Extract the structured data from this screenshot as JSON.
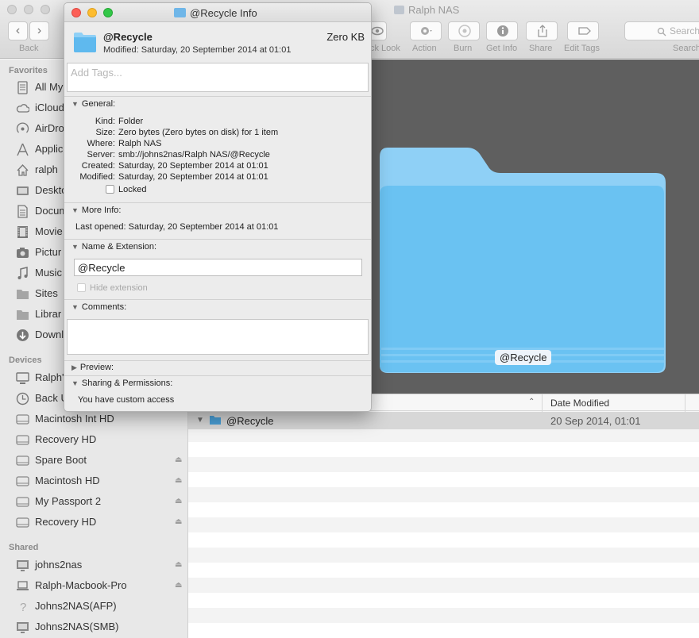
{
  "finder": {
    "title": "Ralph NAS",
    "toolbar": {
      "back_label": "Back",
      "quicklook_label": "ck Look",
      "action_label": "Action",
      "burn_label": "Burn",
      "getinfo_label": "Get Info",
      "share_label": "Share",
      "edittags_label": "Edit Tags",
      "search_placeholder": "Search",
      "search_label": "Search"
    },
    "sidebar": {
      "favorites_heading": "Favorites",
      "favorites": [
        {
          "label": "All My",
          "icon": "all-my-files-icon"
        },
        {
          "label": "iCloud",
          "icon": "cloud-icon"
        },
        {
          "label": "AirDro",
          "icon": "airdrop-icon"
        },
        {
          "label": "Applic",
          "icon": "applications-icon"
        },
        {
          "label": "ralph",
          "icon": "home-icon"
        },
        {
          "label": "Deskto",
          "icon": "desktop-icon"
        },
        {
          "label": "Docum",
          "icon": "documents-icon"
        },
        {
          "label": "Movie",
          "icon": "movies-icon"
        },
        {
          "label": "Pictur",
          "icon": "pictures-icon"
        },
        {
          "label": "Music",
          "icon": "music-icon"
        },
        {
          "label": "Sites",
          "icon": "folder-icon"
        },
        {
          "label": "Librar",
          "icon": "folder-icon"
        },
        {
          "label": "Downl",
          "icon": "downloads-icon"
        }
      ],
      "devices_heading": "Devices",
      "devices": [
        {
          "label": "Ralph'",
          "icon": "computer-icon"
        },
        {
          "label": "Back U",
          "icon": "time-machine-icon"
        },
        {
          "label": "Macintosh Int HD",
          "icon": "disk-icon"
        },
        {
          "label": "Recovery HD",
          "icon": "disk-icon"
        },
        {
          "label": "Spare Boot",
          "icon": "disk-icon",
          "eject": "⏏"
        },
        {
          "label": "Macintosh HD",
          "icon": "disk-icon",
          "eject": "⏏"
        },
        {
          "label": "My Passport 2",
          "icon": "disk-icon",
          "eject": "⏏"
        },
        {
          "label": "Recovery HD",
          "icon": "disk-icon",
          "eject": "⏏"
        }
      ],
      "shared_heading": "Shared",
      "shared": [
        {
          "label": "johns2nas",
          "icon": "display-icon",
          "eject": "⏏"
        },
        {
          "label": "Ralph-Macbook-Pro",
          "icon": "laptop-icon",
          "eject": "⏏"
        },
        {
          "label": "Johns2NAS(AFP)",
          "icon": "question-icon"
        },
        {
          "label": "Johns2NAS(SMB)",
          "icon": "display-icon"
        }
      ]
    },
    "preview_name": "@Recycle",
    "list": {
      "date_header": "Date Modified",
      "sort_indicator": "⌃",
      "rows": [
        {
          "name": "@Recycle",
          "date": "20 Sep 2014, 01:01"
        }
      ]
    }
  },
  "info": {
    "title": "@Recycle Info",
    "name": "@Recycle",
    "size": "Zero KB",
    "modified_line": "Modified: Saturday, 20 September 2014 at 01:01",
    "tags_placeholder": "Add Tags...",
    "general": {
      "heading": "General:",
      "rows": [
        {
          "k": "Kind:",
          "v": "Folder"
        },
        {
          "k": "Size:",
          "v": "Zero bytes (Zero bytes on disk) for 1 item"
        },
        {
          "k": "Where:",
          "v": "Ralph NAS"
        },
        {
          "k": "Server:",
          "v": "smb://johns2nas/Ralph NAS/@Recycle"
        },
        {
          "k": "Created:",
          "v": "Saturday, 20 September 2014 at 01:01"
        },
        {
          "k": "Modified:",
          "v": "Saturday, 20 September 2014 at 01:01"
        }
      ],
      "locked_label": "Locked"
    },
    "more_info": {
      "heading": "More Info:",
      "last_opened": "Last opened: Saturday, 20 September 2014 at 01:01"
    },
    "name_ext": {
      "heading": "Name & Extension:",
      "value": "@Recycle",
      "hide_ext_label": "Hide extension"
    },
    "comments": {
      "heading": "Comments:"
    },
    "preview": {
      "heading": "Preview:"
    },
    "sharing": {
      "heading": "Sharing & Permissions:",
      "access": "You have custom access"
    }
  },
  "colors": {
    "folder_blue": "#6fb6e8",
    "close": "#fc5f57",
    "minimize": "#fdbc2e",
    "zoom": "#33c748",
    "selected_row": "#d7d7d7"
  }
}
